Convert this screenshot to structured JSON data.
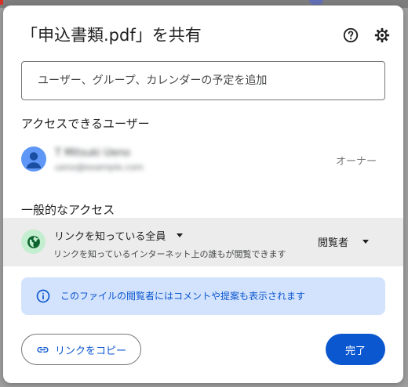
{
  "dialog": {
    "title": "「申込書類.pdf」を共有",
    "help_icon": "help-circle-icon",
    "settings_icon": "gear-icon"
  },
  "people_input": {
    "placeholder": "ユーザー、グループ、カレンダーの予定を追加"
  },
  "access_section": {
    "title": "アクセスできるユーザー",
    "owner": {
      "name": "T Mitsuki Ueno",
      "email": "ueno@example.com",
      "role": "オーナー",
      "avatar_icon": "person-icon"
    }
  },
  "general_access": {
    "title": "一般的なアクセス",
    "icon": "globe-icon",
    "scope": "リンクを知っている全員",
    "description": "リンクを知っているインターネット上の誰もが閲覧できます",
    "role": "閲覧者"
  },
  "info_banner": {
    "icon": "info-icon",
    "text": "このファイルの閲覧者にはコメントや提案も表示されます"
  },
  "buttons": {
    "copy_link": "リンクをコピー",
    "copy_icon": "link-icon",
    "done": "完了"
  },
  "colors": {
    "accent": "#0b57d0",
    "banner_bg": "#d3e3fd",
    "access_row_bg": "#ececec",
    "globe_bg": "#c4eed0",
    "globe_fg": "#0d652d"
  }
}
